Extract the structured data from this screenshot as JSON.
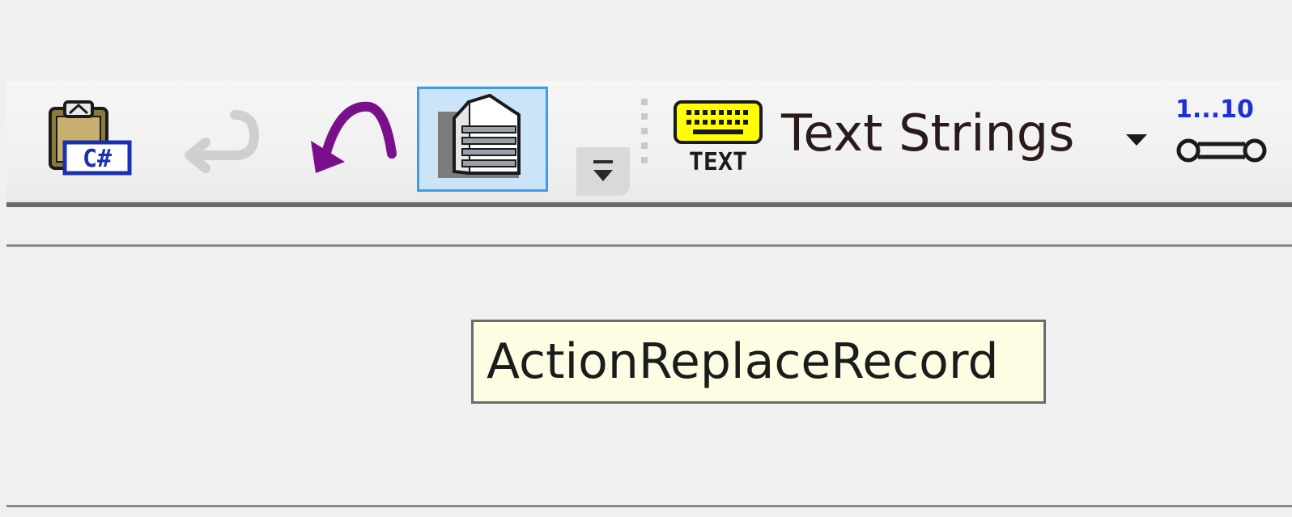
{
  "toolbar": {
    "buttons": [
      {
        "icon": "csharp-clipboard-icon",
        "state": "enabled"
      },
      {
        "icon": "return-arrow-icon",
        "state": "disabled"
      },
      {
        "icon": "undo-arrow-icon",
        "state": "enabled",
        "color": "#7a0f8c"
      },
      {
        "icon": "database-layers-icon",
        "state": "active"
      }
    ],
    "overflow_icon": "chevron-down-icon",
    "text_combo": {
      "icon": "text-keyboard-icon",
      "icon_label": "TEXT",
      "label": "Text Strings",
      "dropdown_icon": "dropdown-arrow-icon"
    },
    "range_button": {
      "icon": "range-slider-icon",
      "label": "1...10"
    }
  },
  "tooltip": {
    "text": "ActionReplaceRecord"
  },
  "colors": {
    "background": "#f0f0f0",
    "active_border": "#3c9cf0",
    "active_fill": "#cce4f7",
    "tooltip_fill": "#fdfde4",
    "keyboard_yellow": "#ffff00",
    "range_blue": "#1f2fd8"
  }
}
